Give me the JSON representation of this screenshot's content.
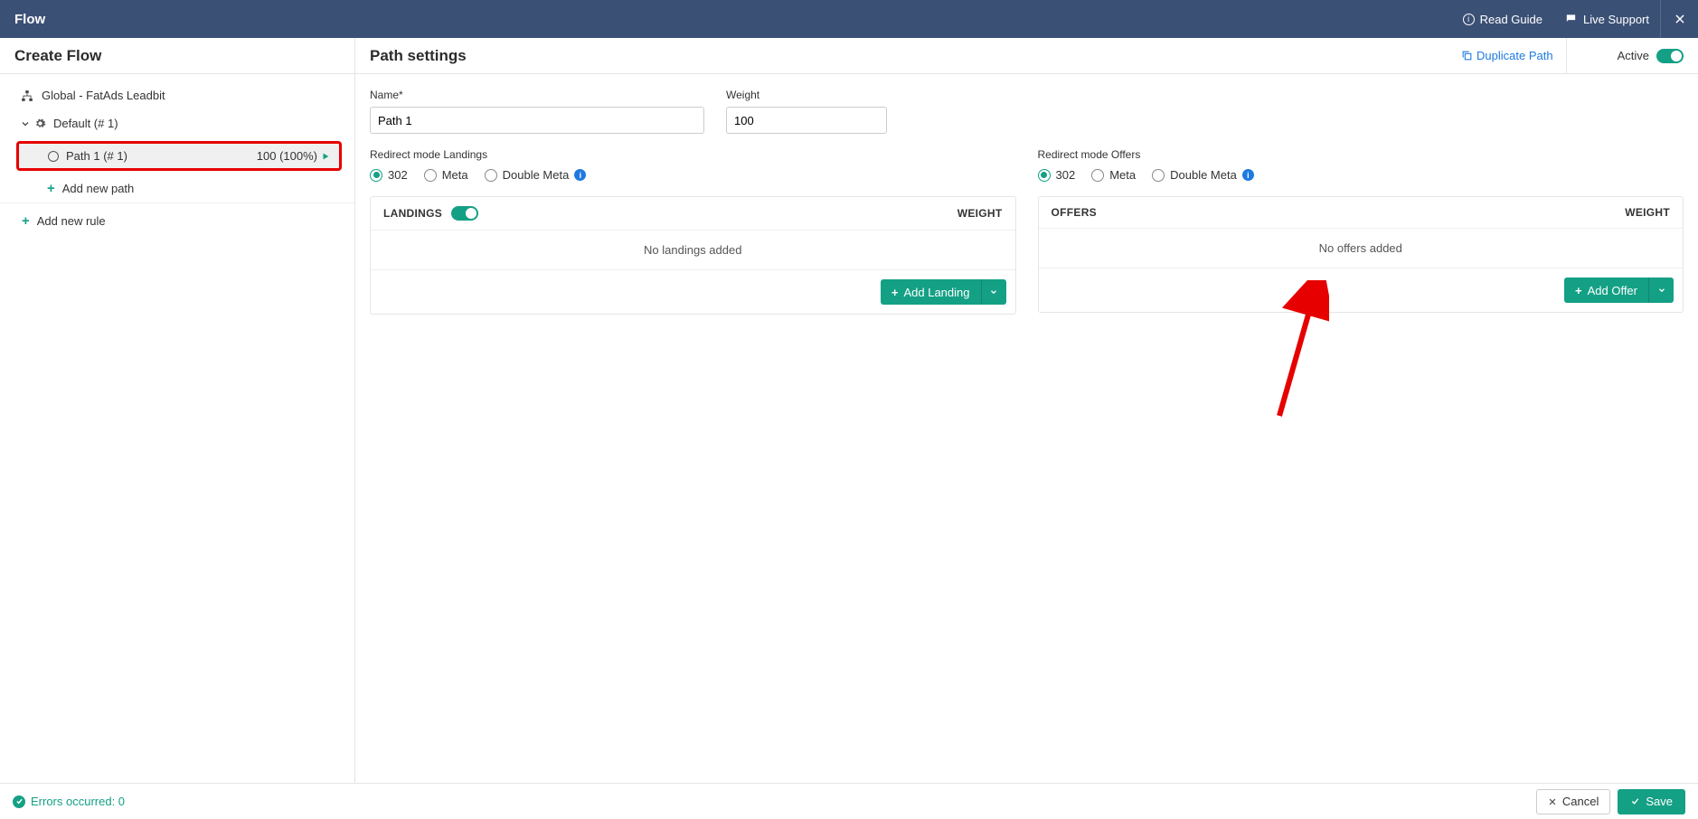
{
  "topbar": {
    "title": "Flow",
    "read_guide": "Read Guide",
    "live_support": "Live Support"
  },
  "sidebar": {
    "title": "Create Flow",
    "global_label": "Global - FatAds Leadbit",
    "default_label": "Default (# 1)",
    "path_item": {
      "label": "Path 1 (# 1)",
      "weight_text": "100 (100%)"
    },
    "add_path": "Add new path",
    "add_rule": "Add new rule"
  },
  "main": {
    "title": "Path settings",
    "duplicate": "Duplicate Path",
    "active_label": "Active",
    "name_label": "Name*",
    "name_value": "Path 1",
    "weight_label": "Weight",
    "weight_value": "100",
    "redirect_landings_label": "Redirect mode Landings",
    "redirect_offers_label": "Redirect mode Offers",
    "radio": {
      "r302": "302",
      "meta": "Meta",
      "double_meta": "Double Meta"
    },
    "landings_panel": {
      "title": "LANDINGS",
      "weight": "WEIGHT",
      "empty": "No landings added",
      "add": "Add Landing"
    },
    "offers_panel": {
      "title": "OFFERS",
      "weight": "WEIGHT",
      "empty": "No offers added",
      "add": "Add Offer"
    }
  },
  "footer": {
    "errors": "Errors occurred: 0",
    "cancel": "Cancel",
    "save": "Save"
  }
}
